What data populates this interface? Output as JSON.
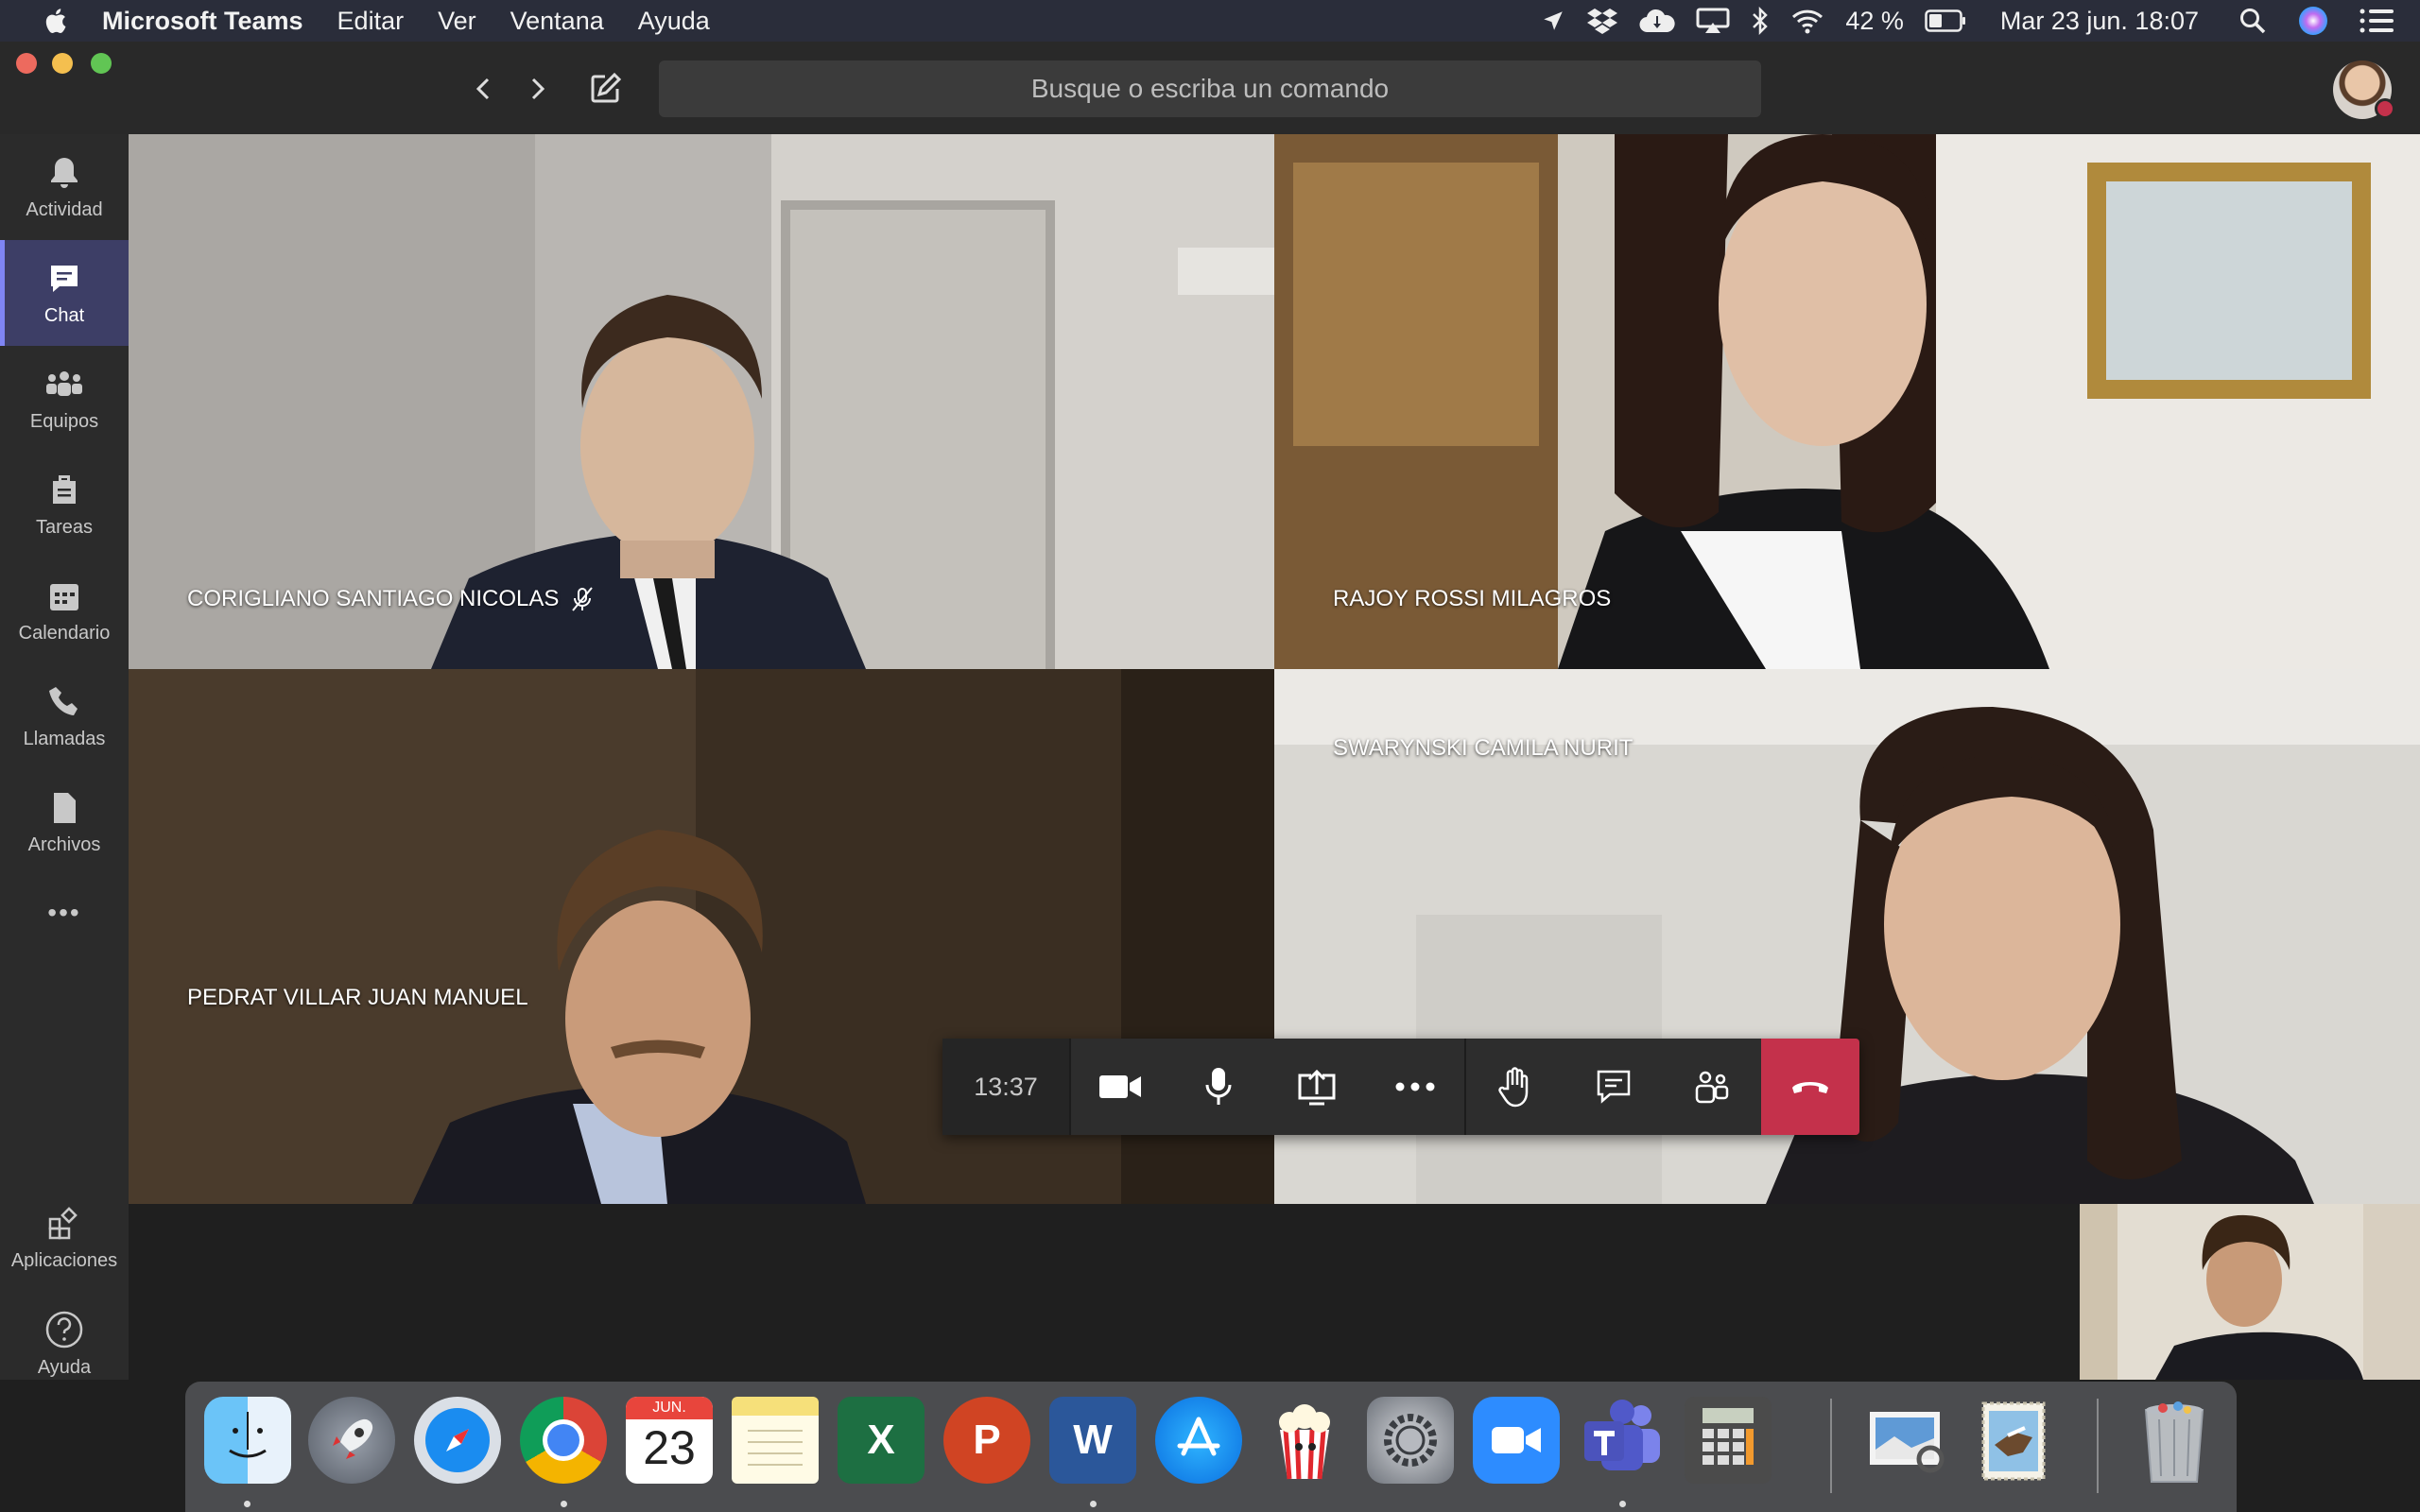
{
  "menubar": {
    "app_name": "Microsoft Teams",
    "menus": [
      "Editar",
      "Ver",
      "Ventana",
      "Ayuda"
    ],
    "battery": "42 %",
    "datetime": "Mar 23 jun.  18:07"
  },
  "titlebar": {
    "search_placeholder": "Busque o escriba un comando"
  },
  "rail": {
    "items": [
      {
        "label": "Actividad",
        "icon": "bell-icon"
      },
      {
        "label": "Chat",
        "icon": "chat-icon"
      },
      {
        "label": "Equipos",
        "icon": "teams-icon"
      },
      {
        "label": "Tareas",
        "icon": "tasks-icon"
      },
      {
        "label": "Calendario",
        "icon": "calendar-icon"
      },
      {
        "label": "Llamadas",
        "icon": "phone-icon"
      },
      {
        "label": "Archivos",
        "icon": "files-icon"
      }
    ],
    "more_label": "•••",
    "apps_label": "Aplicaciones",
    "help_label": "Ayuda"
  },
  "call": {
    "participants": [
      {
        "name": "CORIGLIANO SANTIAGO NICOLAS",
        "muted": true
      },
      {
        "name": "RAJOY ROSSI MILAGROS",
        "muted": false
      },
      {
        "name": "PEDRAT VILLAR JUAN MANUEL",
        "muted": false
      },
      {
        "name": "SWARYNSKI CAMILA NURIT",
        "muted": false
      }
    ],
    "duration": "13:37"
  },
  "dock": {
    "calendar_month": "JUN.",
    "calendar_day": "23"
  },
  "colors": {
    "accent": "#7f85f5",
    "hangup": "#c4314b",
    "rail_active": "#3d3e66"
  }
}
